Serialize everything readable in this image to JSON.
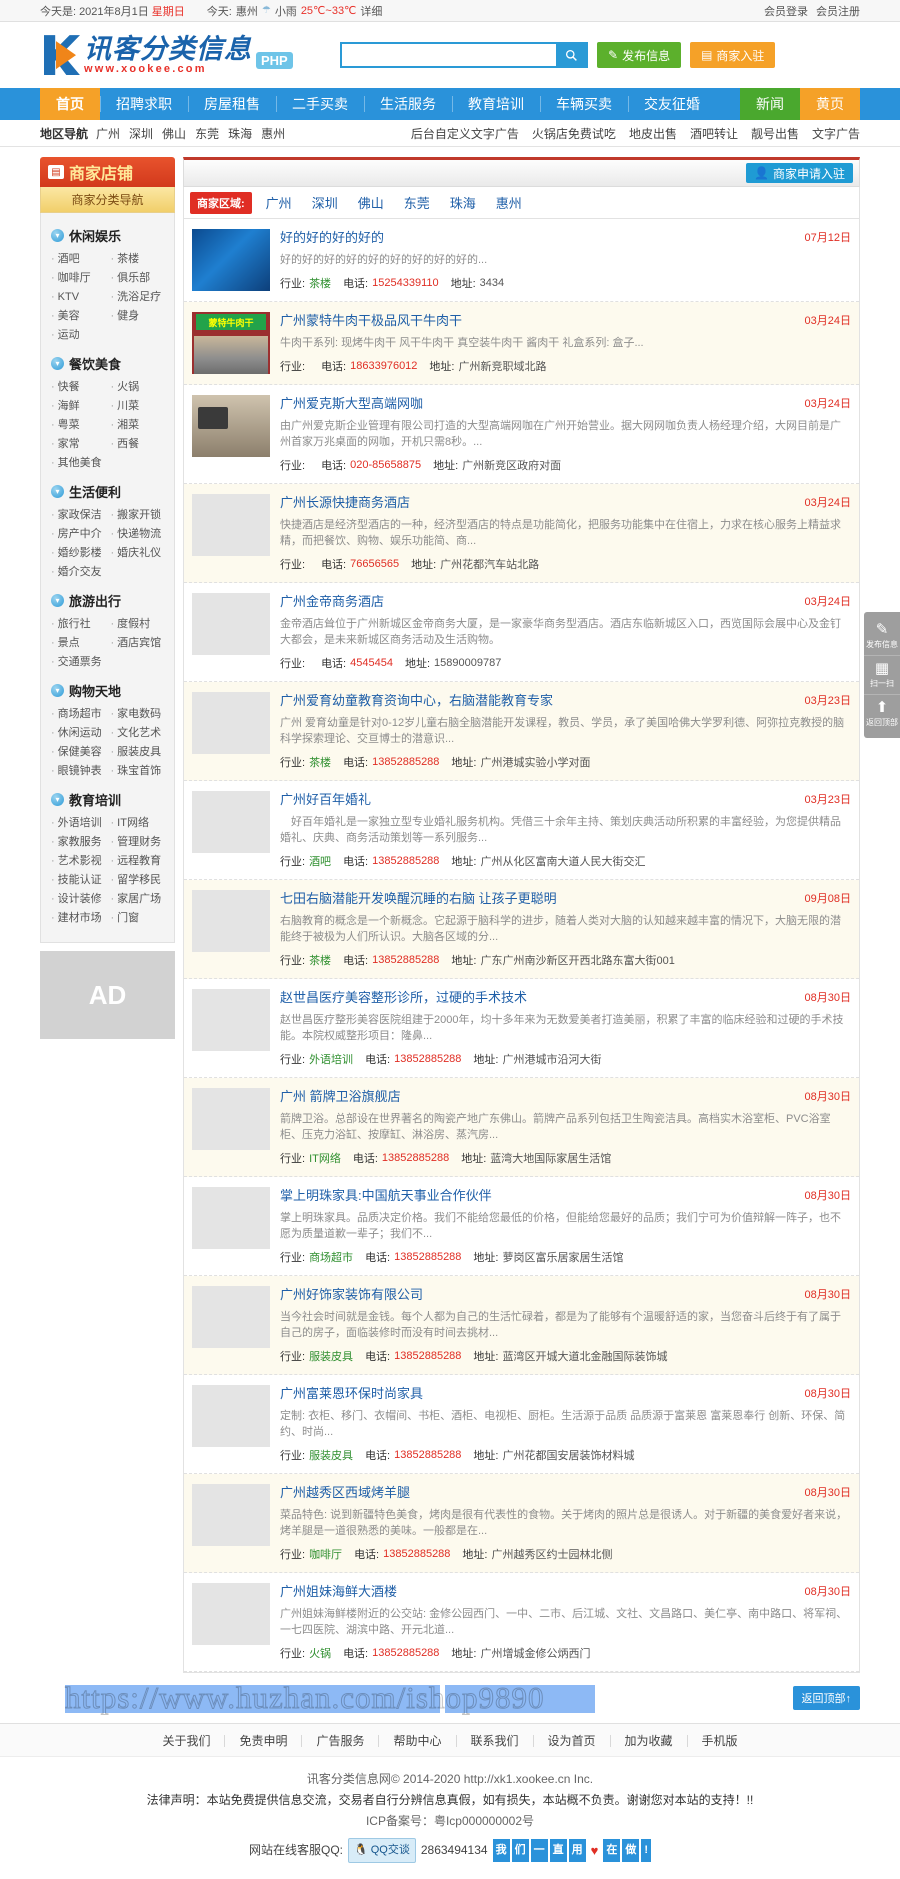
{
  "topbar": {
    "date_prefix": "今天是:",
    "date": "2021年8月1日",
    "weekday": "星期日",
    "today_label": "今天:",
    "city": "惠州",
    "weather": "小雨",
    "temp": "25℃~33℃",
    "detail": "详细",
    "login": "会员登录",
    "register": "会员注册"
  },
  "header": {
    "logo_cn": "讯客分类信息",
    "logo_en": "www.xookee.com",
    "logo_tag": "PHP",
    "search_placeholder": "",
    "search_value": "",
    "search_icon": "search-icon",
    "publish_label": "发布信息",
    "join_label": "商家入驻"
  },
  "nav": {
    "items": [
      {
        "label": "首页",
        "style": "home"
      },
      {
        "label": "招聘求职",
        "style": ""
      },
      {
        "label": "房屋租售",
        "style": ""
      },
      {
        "label": "二手买卖",
        "style": ""
      },
      {
        "label": "生活服务",
        "style": ""
      },
      {
        "label": "教育培训",
        "style": ""
      },
      {
        "label": "车辆买卖",
        "style": ""
      },
      {
        "label": "交友征婚",
        "style": ""
      }
    ],
    "right": [
      {
        "label": "新闻",
        "style": "news"
      },
      {
        "label": "黄页",
        "style": "yellow"
      }
    ]
  },
  "regionbar": {
    "title": "地区导航",
    "cities": [
      "广州",
      "深圳",
      "佛山",
      "东莞",
      "珠海",
      "惠州"
    ],
    "ads": [
      "后台自定义文字广告",
      "火锅店免费试吃",
      "地皮出售",
      "酒吧转让",
      "靓号出售",
      "文字广告"
    ]
  },
  "sidebar": {
    "title": "商家店铺",
    "subtitle": "商家分类导航",
    "ad_label": "AD",
    "groups": [
      {
        "name": "休闲娱乐",
        "items": [
          "酒吧",
          "茶楼",
          "咖啡厅",
          "俱乐部",
          "KTV",
          "洗浴足疗",
          "美容",
          "健身",
          "运动"
        ]
      },
      {
        "name": "餐饮美食",
        "items": [
          "快餐",
          "火锅",
          "海鲜",
          "川菜",
          "粤菜",
          "湘菜",
          "家常",
          "西餐",
          "其他美食"
        ]
      },
      {
        "name": "生活便利",
        "items": [
          "家政保洁",
          "搬家开锁",
          "房产中介",
          "快递物流",
          "婚纱影楼",
          "婚庆礼仪",
          "婚介交友"
        ]
      },
      {
        "name": "旅游出行",
        "items": [
          "旅行社",
          "度假村",
          "景点",
          "酒店宾馆",
          "交通票务"
        ]
      },
      {
        "name": "购物天地",
        "items": [
          "商场超市",
          "家电数码",
          "休闲运动",
          "文化艺术",
          "保健美容",
          "服装皮具",
          "眼镜钟表",
          "珠宝首饰"
        ]
      },
      {
        "name": "教育培训",
        "items": [
          "外语培训",
          "IT网络",
          "家教服务",
          "管理财务",
          "艺术影视",
          "远程教育",
          "技能认证",
          "留学移民",
          "设计装修",
          "家居广场",
          "建材市场",
          "门窗"
        ]
      }
    ]
  },
  "main": {
    "apply_label": "商家申请入驻",
    "filter_label": "商家区域:",
    "filter_cities": [
      "广州",
      "深圳",
      "佛山",
      "东莞",
      "珠海",
      "惠州"
    ],
    "labels": {
      "trade": "行业:",
      "phone": "电话:",
      "address": "地址:"
    },
    "listings": [
      {
        "title": "好的好的好的好的",
        "desc": "好的好的好的好的好的好的好的好的好的...",
        "trade": "茶楼",
        "phone": "15254339110",
        "address": "3434",
        "date": "07月12日",
        "thumb": "t1"
      },
      {
        "title": "广州蒙特牛肉干极品风干牛肉干",
        "desc": "牛肉干系列: 现烤牛肉干 风干牛肉干 真空装牛肉干 酱肉干 礼盒系列: 盒子...",
        "trade": "",
        "phone": "18633976012",
        "address": "广州新竞职域北路",
        "date": "03月24日",
        "thumb": "t2"
      },
      {
        "title": "广州爱克斯大型高端网咖",
        "desc": "由广州爱克斯企业管理有限公司打造的大型高端网咖在广州开始营业。据大网网咖负责人杨经理介绍，大网目前是广州首家万兆桌面的网咖，开机只需8秒。...",
        "trade": "",
        "phone": "020-85658875",
        "address": "广州新竞区政府对面",
        "date": "03月24日",
        "thumb": "t3"
      },
      {
        "title": "广州长源快捷商务酒店",
        "desc": "快捷酒店是经济型酒店的一种，经济型酒店的特点是功能简化，把服务功能集中在住宿上，力求在核心服务上精益求精，而把餐饮、购物、娱乐功能简、商...",
        "trade": "",
        "phone": "76656565",
        "address": "广州花都汽车站北路",
        "date": "03月24日",
        "thumb": ""
      },
      {
        "title": "广州金帝商务酒店",
        "desc": "金帝酒店耸位于广州新城区金帝商务大厦，是一家豪华商务型酒店。酒店东临新城区入口，西览国际会展中心及金钉大都会，是未来新城区商务活动及生活购物。",
        "trade": "",
        "phone": "4545454",
        "address": "15890009787",
        "date": "03月24日",
        "thumb": ""
      },
      {
        "title": "广州爱育幼童教育资询中心，右脑潜能教育专家",
        "desc": "广州 爱育幼童是针对0-12岁儿童右脑全脑潜能开发课程，教员、学员，承了美国哈佛大学罗利德、阿弥拉克教授的脑科学探索理论、交亘博士的潜意识...",
        "trade": "茶楼",
        "phone": "13852885288",
        "address": "广州港城实验小学对面",
        "date": "03月23日",
        "thumb": ""
      },
      {
        "title": "广州好百年婚礼",
        "desc": "　好百年婚礼是一家独立型专业婚礼服务机构。凭借三十余年主持、策划庆典活动所积累的丰富经验，为您提供精品婚礼、庆典、商务活动策划等一系列服务...",
        "trade": "酒吧",
        "phone": "13852885288",
        "address": "广州从化区富南大道人民大街交汇",
        "date": "03月23日",
        "thumb": ""
      },
      {
        "title": "七田右脑潜能开发唤醒沉睡的右脑 让孩子更聪明",
        "desc": "右脑教育的概念是一个新概念。它起源于脑科学的进步，随着人类对大脑的认知越来越丰富的情况下，大脑无限的潜能终于被极为人们所认识。大脑各区域的分...",
        "trade": "茶楼",
        "phone": "13852885288",
        "address": "广东广州南沙新区开西北路东富大街001",
        "date": "09月08日",
        "thumb": ""
      },
      {
        "title": "赵世昌医疗美容整形诊所，过硬的手术技术",
        "desc": "赵世昌医疗整形美容医院组建于2000年，均十多年来为无数爱美者打造美丽，积累了丰富的临床经验和过硬的手术技能。本院权威整形项目：隆鼻...",
        "trade": "外语培训",
        "phone": "13852885288",
        "address": "广州港城市沿河大街",
        "date": "08月30日",
        "thumb": ""
      },
      {
        "title": "广州 箭牌卫浴旗舰店",
        "desc": "箭牌卫浴。总部设在世界著名的陶瓷产地广东佛山。箭牌产品系列包括卫生陶瓷洁具。高档实木浴室柜、PVC浴室柜、压克力浴缸、按摩缸、淋浴房、蒸汽房...",
        "trade": "IT网络",
        "phone": "13852885288",
        "address": "蓝湾大地国际家居生活馆",
        "date": "08月30日",
        "thumb": ""
      },
      {
        "title": "掌上明珠家具:中国航天事业合作伙伴",
        "desc": "掌上明珠家具。品质决定价格。我们不能给您最低的价格，但能给您最好的品质；我们宁可为价值辩解一阵子，也不愿为质量道歉一辈子；我们不...",
        "trade": "商场超市",
        "phone": "13852885288",
        "address": "萝岗区富乐居家居生活馆",
        "date": "08月30日",
        "thumb": ""
      },
      {
        "title": "广州好饰家装饰有限公司",
        "desc": "当今社会时间就是金钱。每个人都为自己的生活忙碌着，都是为了能够有个温暖舒适的家，当您奋斗后终于有了属于自己的房子，面临装修时而没有时间去挑材...",
        "trade": "服装皮具",
        "phone": "13852885288",
        "address": "蓝湾区开城大道北金融国际装饰城",
        "date": "08月30日",
        "thumb": ""
      },
      {
        "title": "广州富莱恩环保时尚家具",
        "desc": "定制: 衣柜、移门、衣帽间、书柜、酒柜、电视柜、厨柜。生活源于品质 品质源于富莱恩 富莱恩奉行 创新、环保、简约、时尚...",
        "trade": "服装皮具",
        "phone": "13852885288",
        "address": "广州花都国安居装饰材料城",
        "date": "08月30日",
        "thumb": ""
      },
      {
        "title": "广州越秀区西域烤羊腿",
        "desc": "菜品特色: 说到新疆特色美食，烤肉是很有代表性的食物。关于烤肉的照片总是很诱人。对于新疆的美食爱好者来说，烤羊腿是一道很熟悉的美味。一般都是在...",
        "trade": "咖啡厅",
        "phone": "13852885288",
        "address": "广州越秀区约士园林北侧",
        "date": "08月30日",
        "thumb": ""
      },
      {
        "title": "广州姐妹海鲜大酒楼",
        "desc": "广州姐妹海鲜楼附近的公交站: 金修公园西门、一中、二市、后江城、文社、文昌路口、美仁亭、南中路口、将军祠、一七四医院、湖滨中路、开元北道...",
        "trade": "火锅",
        "phone": "13852885288",
        "address": "广州增城金修公炳西门",
        "date": "08月30日",
        "thumb": ""
      }
    ]
  },
  "watermark": {
    "text": "https://www.huzhan.com/ishop9890",
    "back_top": "返回顶部↑"
  },
  "footer": {
    "links": [
      "关于我们",
      "免责申明",
      "广告服务",
      "帮助中心",
      "联系我们",
      "设为首页",
      "加为收藏",
      "手机版"
    ],
    "copyright": "讯客分类信息网© 2014-2020 http://xk1.xookee.cn Inc.",
    "legal": "法律声明：本站免费提供信息交流，交易者自行分辨信息真假，如有损失，本站概不负责。谢谢您对本站的支持！!!",
    "icp": "ICP备案号：粤Icp000000002号",
    "qq_label": "网站在线客服QQ:",
    "qq_btn": "QQ交谈",
    "qq_number": "2863494134",
    "slogan": [
      "我",
      "们",
      "一",
      "直",
      "用",
      "♥",
      "在",
      "做",
      "!"
    ]
  },
  "rightbar": {
    "items": [
      {
        "icon": "pencil-icon",
        "glyph": "✎",
        "label": "发布信息"
      },
      {
        "icon": "qrcode-icon",
        "glyph": "▦",
        "label": "扫一扫"
      },
      {
        "icon": "arrow-up-icon",
        "glyph": "⬆",
        "label": "返回顶部"
      }
    ]
  }
}
